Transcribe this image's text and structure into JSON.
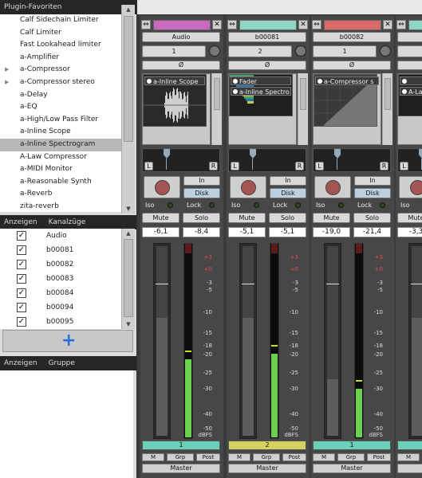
{
  "left": {
    "plugins_header": "Plugin-Favoriten",
    "plugins": [
      {
        "label": "Calf Sidechain Limiter",
        "arrow": false
      },
      {
        "label": "Calf Limiter",
        "arrow": false
      },
      {
        "label": "Fast Lookahead limiter",
        "arrow": false
      },
      {
        "label": "a-Amplifier",
        "arrow": false
      },
      {
        "label": "a-Compressor",
        "arrow": true
      },
      {
        "label": "a-Compressor stereo",
        "arrow": true
      },
      {
        "label": "a-Delay",
        "arrow": false
      },
      {
        "label": "a-EQ",
        "arrow": false
      },
      {
        "label": "a-High/Low Pass Filter",
        "arrow": false
      },
      {
        "label": "a-Inline Scope",
        "arrow": false
      },
      {
        "label": "a-Inline Spectrogram",
        "arrow": false,
        "selected": true
      },
      {
        "label": "A-Law Compressor",
        "arrow": false
      },
      {
        "label": "a-MIDI Monitor",
        "arrow": false
      },
      {
        "label": "a-Reasonable Synth",
        "arrow": false
      },
      {
        "label": "a-Reverb",
        "arrow": false
      },
      {
        "label": "zita-reverb",
        "arrow": false
      }
    ],
    "tracks_header": {
      "show": "Anzeigen",
      "title": "Kanalzüge"
    },
    "tracks": [
      "Audio",
      "b00081",
      "b00082",
      "b00083",
      "b00084",
      "b00094",
      "b00095"
    ],
    "add_button_icon": "plus-icon",
    "groups_header": {
      "show": "Anzeigen",
      "title": "Gruppe"
    }
  },
  "strip_common": {
    "phase": "Ø",
    "in": "In",
    "disk": "Disk",
    "iso": "Iso",
    "lock": "Lock",
    "mute": "Mute",
    "solo": "Solo",
    "m": "M",
    "grp": "Grp",
    "post": "Post",
    "master": "Master",
    "pan_l": "L",
    "pan_r": "R",
    "dbfs": "dBFS",
    "scale": [
      "+3",
      "+0",
      "-3",
      "-5",
      "-10",
      "-15",
      "-18",
      "-20",
      "-25",
      "-30",
      "-40",
      "-50"
    ]
  },
  "strips": [
    {
      "name": "Audio",
      "color": "#c86bc0",
      "input": "1",
      "plugins": [
        "a-Inline Scope"
      ],
      "gain": "-6,1",
      "peak": "-8,4",
      "bus": "1",
      "bus_color": "#6ad0b8",
      "fader": 0.62,
      "meter": 0.4
    },
    {
      "name": "b00081",
      "color": "#8fd6c4",
      "input": "2",
      "plugins": [
        "Fader",
        "a-Inline Spectro"
      ],
      "gain": "-5,1",
      "peak": "-5,1",
      "bus": "2",
      "bus_color": "#d6d060",
      "fader": 0.62,
      "meter": 0.43
    },
    {
      "name": "b00082",
      "color": "#d86a6a",
      "input": "1",
      "plugins": [
        "a-Compressor s"
      ],
      "gain": "-19,0",
      "peak": "-21,4",
      "bus": "1",
      "bus_color": "#6ad0b8",
      "fader": 0.3,
      "meter": 0.25
    },
    {
      "name": "",
      "color": "#8fd6c4",
      "input": "",
      "plugins": [
        "",
        "A-La"
      ],
      "gain": "-3,3",
      "peak": "",
      "bus": "",
      "bus_color": "#6ad0b8",
      "fader": 0.62,
      "meter": 0.5
    }
  ]
}
